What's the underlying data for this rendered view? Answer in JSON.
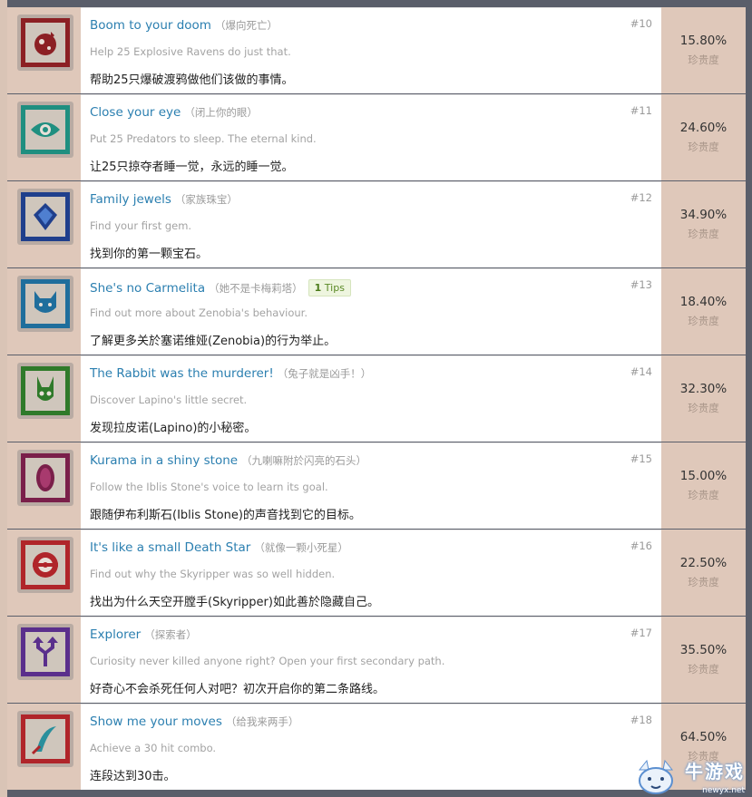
{
  "rarity_label": "珍贵度",
  "watermark": {
    "text": "牛游戏",
    "url": "newyx.net"
  },
  "achievements": [
    {
      "title": "Boom to your doom",
      "title_cn": "（爆向死亡）",
      "num": "#10",
      "desc": "Help 25 Explosive Ravens do just that.",
      "desc_cn": "帮助25只爆破渡鸦做他们该做的事情。",
      "pct": "15.80%",
      "icon": "bomb-icon",
      "color": "#8c2024"
    },
    {
      "title": "Close your eye",
      "title_cn": "（闭上你的眼）",
      "num": "#11",
      "desc": "Put 25 Predators to sleep. The eternal kind.",
      "desc_cn": "让25只掠夺者睡一觉，永远的睡一觉。",
      "pct": "24.60%",
      "icon": "eye-icon",
      "color": "#1f8f80"
    },
    {
      "title": "Family jewels",
      "title_cn": "（家族珠宝）",
      "num": "#12",
      "desc": "Find your first gem.",
      "desc_cn": "找到你的第一颗宝石。",
      "pct": "34.90%",
      "icon": "gem-icon",
      "color": "#1f3f8c"
    },
    {
      "title": "She's no Carmelita",
      "title_cn": "（她不是卡梅莉塔）",
      "num": "#13",
      "desc": "Find out more about Zenobia's behaviour.",
      "desc_cn": "了解更多关於塞诺维娅(Zenobia)的行为举止。",
      "pct": "18.40%",
      "icon": "cat-mask-icon",
      "color": "#1f6e9c",
      "tips": {
        "count": "1",
        "label": "Tips"
      }
    },
    {
      "title": "The Rabbit was the murderer!",
      "title_cn": "（兔子就是凶手！）",
      "num": "#14",
      "desc": "Discover Lapino's little secret.",
      "desc_cn": "发现拉皮诺(Lapino)的小秘密。",
      "pct": "32.30%",
      "icon": "rabbit-icon",
      "color": "#2f7a2a"
    },
    {
      "title": "Kurama in a shiny stone",
      "title_cn": "（九喇嘛附於闪亮的石头）",
      "num": "#15",
      "desc": "Follow the Iblis Stone's voice to learn its goal.",
      "desc_cn": "跟随伊布利斯石(Iblis Stone)的声音找到它的目标。",
      "pct": "15.00%",
      "icon": "stone-icon",
      "color": "#7a1f4a"
    },
    {
      "title": "It's like a small Death Star",
      "title_cn": "（就像一颗小死星）",
      "num": "#16",
      "desc": "Find out why the Skyripper was so well hidden.",
      "desc_cn": "找出为什么天空开膛手(Skyripper)如此善於隐藏自己。",
      "pct": "22.50%",
      "icon": "death-star-icon",
      "color": "#b0252a"
    },
    {
      "title": "Explorer",
      "title_cn": "（探索者）",
      "num": "#17",
      "desc": "Curiosity never killed anyone right? Open your first secondary path.",
      "desc_cn": "好奇心不会杀死任何人对吧？初次开启你的第二条路线。",
      "pct": "35.50%",
      "icon": "fork-arrow-icon",
      "color": "#5a2f8c"
    },
    {
      "title": "Show me your moves",
      "title_cn": "（给我来两手）",
      "num": "#18",
      "desc": "Achieve a 30 hit combo.",
      "desc_cn": "连段达到30击。",
      "pct": "64.50%",
      "icon": "slash-icon",
      "color": "#b0252a"
    }
  ]
}
